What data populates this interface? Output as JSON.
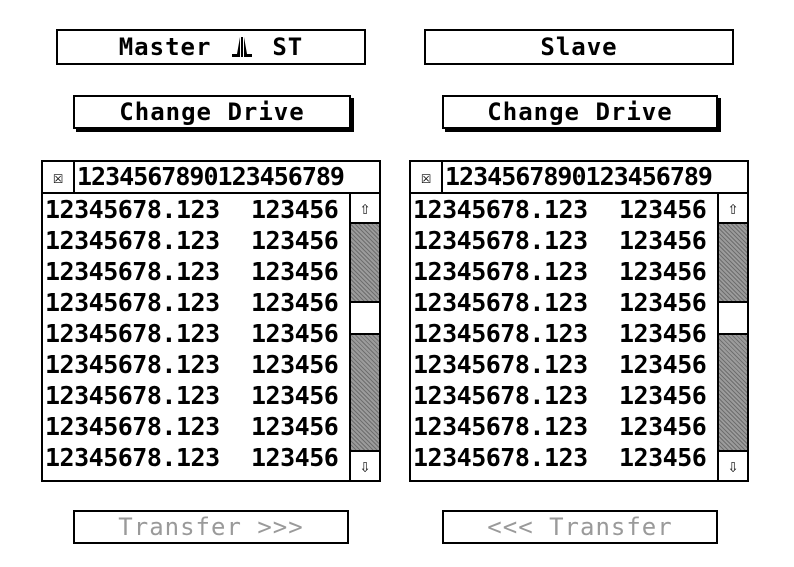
{
  "left": {
    "title": "Master ⫻⫻ ST",
    "change_drive": "Change Drive",
    "transfer": "Transfer >>>",
    "path": "1234567890123456789",
    "close_glyph": "☒",
    "files": [
      {
        "name": "12345678.123",
        "size": "123456"
      },
      {
        "name": "12345678.123",
        "size": "123456"
      },
      {
        "name": "12345678.123",
        "size": "123456"
      },
      {
        "name": "12345678.123",
        "size": "123456"
      },
      {
        "name": "12345678.123",
        "size": "123456"
      },
      {
        "name": "12345678.123",
        "size": "123456"
      },
      {
        "name": "12345678.123",
        "size": "123456"
      },
      {
        "name": "12345678.123",
        "size": "123456"
      },
      {
        "name": "12345678.123",
        "size": "123456"
      }
    ],
    "scroll_position": 0.4
  },
  "right": {
    "title": "Slave",
    "change_drive": "Change Drive",
    "transfer": "<<< Transfer",
    "path": "1234567890123456789",
    "close_glyph": "☒",
    "files": [
      {
        "name": "12345678.123",
        "size": "123456"
      },
      {
        "name": "12345678.123",
        "size": "123456"
      },
      {
        "name": "12345678.123",
        "size": "123456"
      },
      {
        "name": "12345678.123",
        "size": "123456"
      },
      {
        "name": "12345678.123",
        "size": "123456"
      },
      {
        "name": "12345678.123",
        "size": "123456"
      },
      {
        "name": "12345678.123",
        "size": "123456"
      },
      {
        "name": "12345678.123",
        "size": "123456"
      },
      {
        "name": "12345678.123",
        "size": "123456"
      }
    ],
    "scroll_position": 0.4
  },
  "icons": {
    "scroll_up": "⇧",
    "scroll_down": "⇩",
    "atari_logo": "atari-logo-icon"
  },
  "colors": {
    "background": "#ffffff",
    "foreground": "#000000",
    "disabled_text": "#9a9a9a",
    "scroll_track": "#9b9b9b"
  }
}
